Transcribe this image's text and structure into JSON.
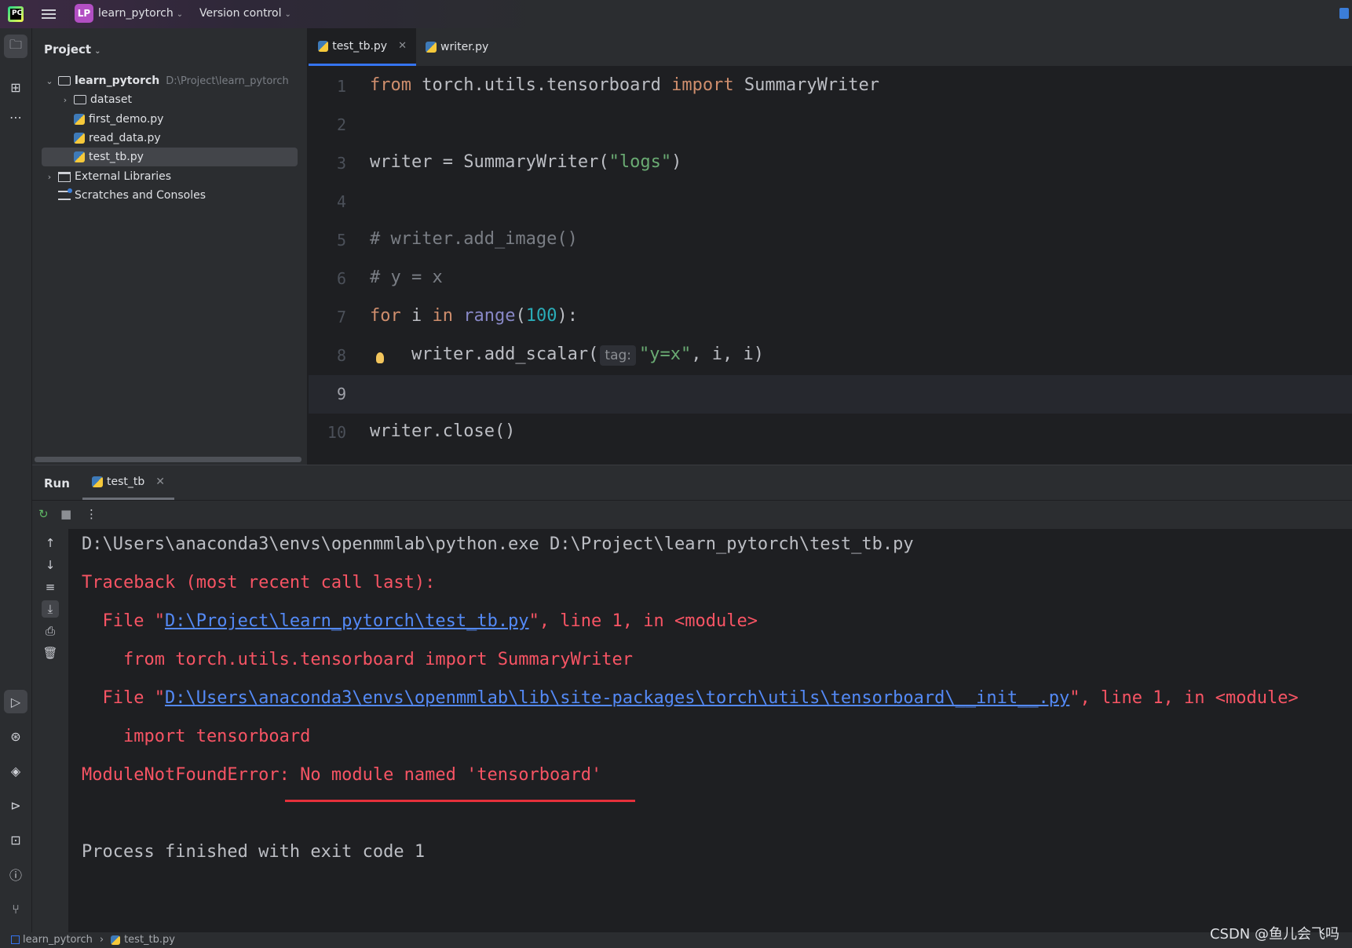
{
  "titlebar": {
    "logo_text": "PC",
    "project_badge": "LP",
    "project_name": "learn_pytorch",
    "version_control": "Version control"
  },
  "project_panel": {
    "header": "Project",
    "root": {
      "name": "learn_pytorch",
      "path": "D:\\Project\\learn_pytorch"
    },
    "items": [
      {
        "label": "dataset",
        "type": "folder"
      },
      {
        "label": "first_demo.py",
        "type": "python"
      },
      {
        "label": "read_data.py",
        "type": "python"
      },
      {
        "label": "test_tb.py",
        "type": "python",
        "selected": true
      }
    ],
    "external": "External Libraries",
    "scratches": "Scratches and Consoles"
  },
  "editor": {
    "tabs": [
      {
        "label": "test_tb.py",
        "active": true
      },
      {
        "label": "writer.py",
        "active": false
      }
    ],
    "line_numbers": [
      "1",
      "2",
      "3",
      "4",
      "5",
      "6",
      "7",
      "8",
      "9",
      "10"
    ],
    "current_line": 9,
    "code": {
      "l1_kw1": "from",
      "l1_mod": " torch.utils.tensorboard ",
      "l1_kw2": "import",
      "l1_name": " SummaryWriter",
      "l3_a": "writer = SummaryWriter(",
      "l3_str": "\"logs\"",
      "l3_b": ")",
      "l5": "# writer.add_image()",
      "l6": "# y = x",
      "l7_kw1": "for",
      "l7_a": " i ",
      "l7_kw2": "in",
      "l7_sp": " ",
      "l7_range": "range",
      "l7_p1": "(",
      "l7_num": "100",
      "l7_p2": "):",
      "l8_a": "    writer.add_scalar(",
      "l8_hint": "tag:",
      "l8_str": "\"y=x\"",
      "l8_b": ", i, i)",
      "l10": "writer.close()"
    }
  },
  "run_panel": {
    "title": "Run",
    "tab": "test_tb",
    "console": {
      "cmd": "D:\\Users\\anaconda3\\envs\\openmmlab\\python.exe D:\\Project\\learn_pytorch\\test_tb.py",
      "traceback": "Traceback (most recent call last):",
      "f1_pre": "  File \"",
      "f1_link": "D:\\Project\\learn_pytorch\\test_tb.py",
      "f1_post": "\", line 1, in <module>",
      "f1_code": "    from torch.utils.tensorboard import SummaryWriter",
      "f2_pre": "  File \"",
      "f2_link": "D:\\Users\\anaconda3\\envs\\openmmlab\\lib\\site-packages\\torch\\utils\\tensorboard\\__init__.py",
      "f2_post": "\", line 1, in <module>",
      "f2_code": "    import tensorboard",
      "error": "ModuleNotFoundError: No module named 'tensorboard'",
      "exit": "Process finished with exit code 1"
    }
  },
  "statusbar": {
    "project": "learn_pytorch",
    "file": "test_tb.py"
  },
  "watermark": "CSDN @鱼儿会飞吗",
  "colors": {
    "accent": "#3574f0",
    "error": "#f75464",
    "link": "#548af7",
    "keyword": "#cf8e6d",
    "string": "#6aab73",
    "number": "#2aacb8",
    "annotation_underline": "#e5303b"
  }
}
